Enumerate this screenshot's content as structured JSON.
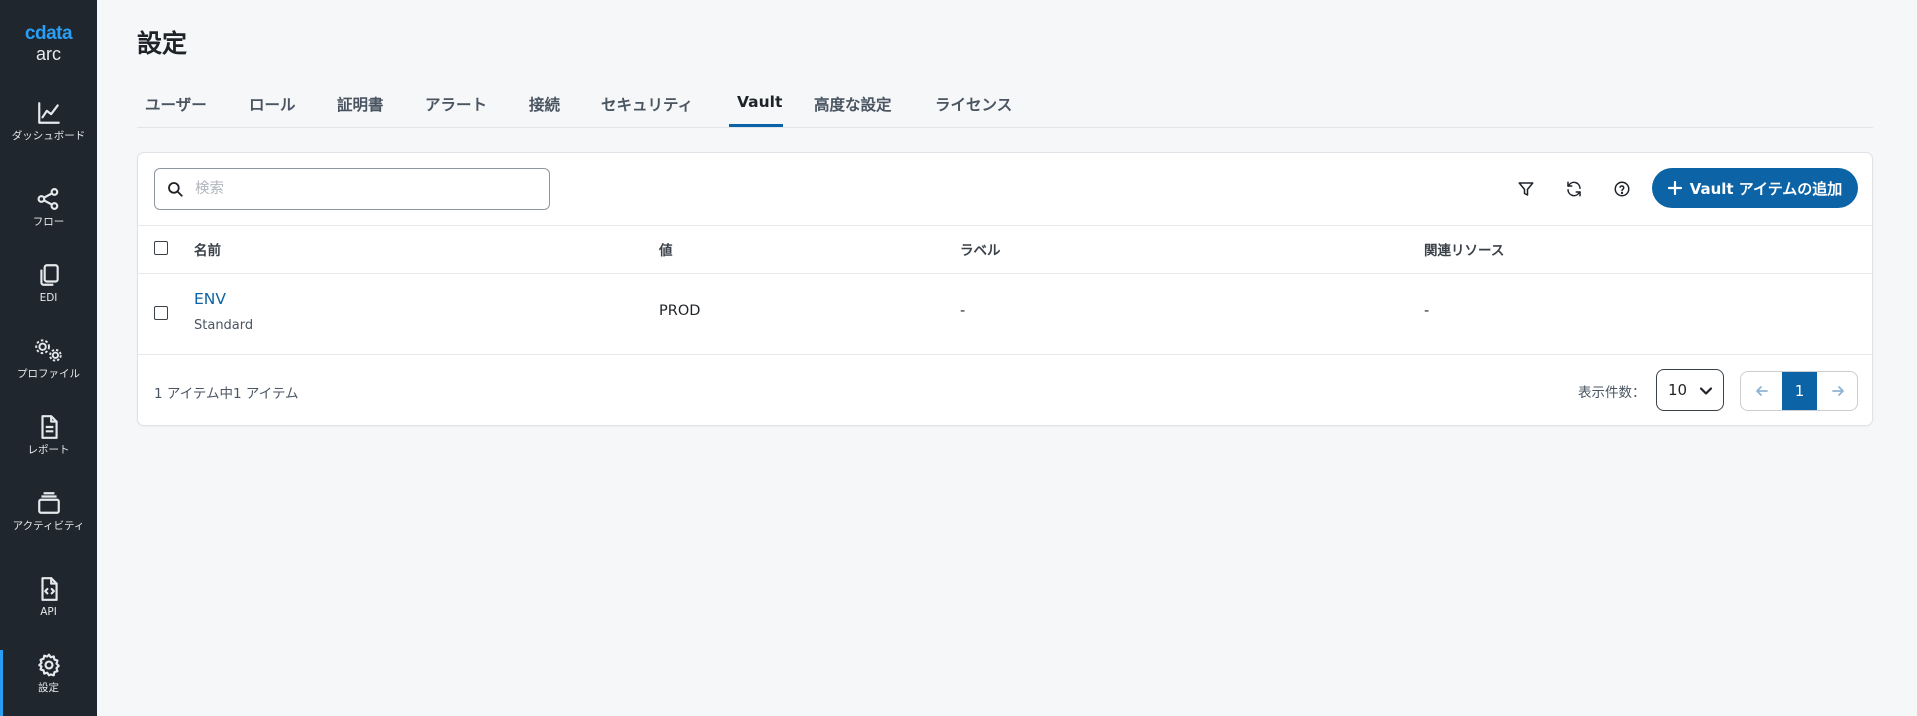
{
  "brand": {
    "name": "cdata",
    "product": "arc"
  },
  "sidebar": {
    "items": [
      {
        "label": "ダッシュボード"
      },
      {
        "label": "フロー"
      },
      {
        "label": "EDI"
      },
      {
        "label": "プロファイル"
      },
      {
        "label": "レポート"
      },
      {
        "label": "アクティビティ"
      },
      {
        "label": "API"
      },
      {
        "label": "設定"
      }
    ],
    "active_index": 7
  },
  "page": {
    "title": "設定"
  },
  "tabs": [
    {
      "label": "ユーザー"
    },
    {
      "label": "ロール"
    },
    {
      "label": "証明書"
    },
    {
      "label": "アラート"
    },
    {
      "label": "接続"
    },
    {
      "label": "セキュリティ"
    },
    {
      "label": "Vault"
    },
    {
      "label": "高度な設定"
    },
    {
      "label": "ライセンス"
    }
  ],
  "active_tab": "Vault",
  "toolbar": {
    "search_placeholder": "検索",
    "search_value": "",
    "add_button_label": "Vault アイテムの追加"
  },
  "table": {
    "columns": [
      "名前",
      "値",
      "ラベル",
      "関連リソース"
    ],
    "rows": [
      {
        "name": "ENV",
        "type": "Standard",
        "value": "PROD",
        "label": "-",
        "related": "-"
      }
    ]
  },
  "footer": {
    "count_text": "1 アイテム中1 アイテム",
    "per_page_label": "表示件数：",
    "per_page_value": "10",
    "current_page": "1"
  },
  "colors": {
    "accent": "#0c63a5",
    "sidebar_bg": "#1f262d",
    "brand": "#2a9df4"
  }
}
